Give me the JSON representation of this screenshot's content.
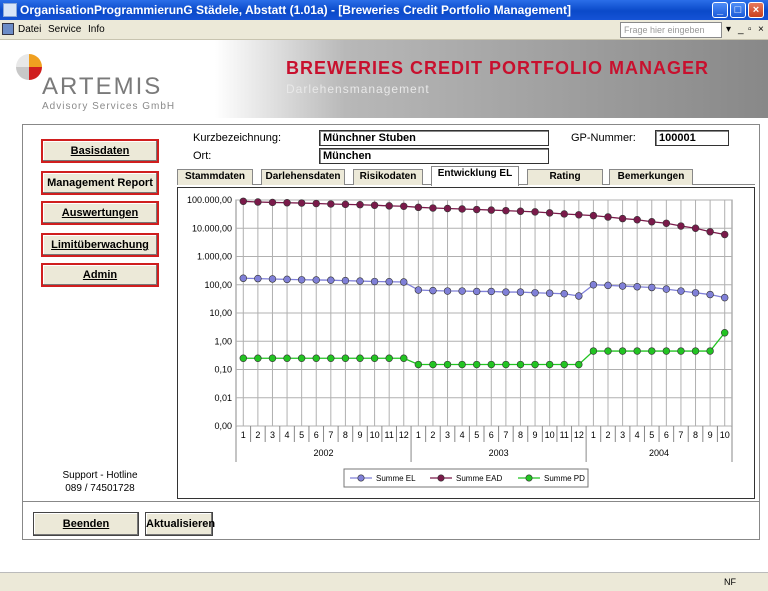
{
  "window": {
    "title": "OrganisationProgrammierunG Städele, Abstatt (1.01a) - [Breweries Credit Portfolio Management]"
  },
  "menu": {
    "items": [
      "Datei",
      "Service",
      "Info"
    ],
    "help_placeholder": "Frage hier eingeben"
  },
  "banner": {
    "logo": "ARTEMIS",
    "logo_sub": "Advisory Services GmbH",
    "title": "BREWERIES CREDIT PORTFOLIO MANAGER",
    "subtitle": "Darlehensmanagement"
  },
  "nav": {
    "basisdaten": "Basisdaten",
    "management_report": "Management Report",
    "auswertungen": "Auswertungen",
    "limitueberwachung": "Limitüberwachung",
    "admin": "Admin"
  },
  "support": {
    "line1": "Support - Hotline",
    "line2": "089 / 74501728"
  },
  "header_fields": {
    "kurz_label": "Kurzbezeichnung:",
    "kurz_value": "Münchner Stuben",
    "ort_label": "Ort:",
    "ort_value": "München",
    "gp_label": "GP-Nummer:",
    "gp_value": "100001"
  },
  "tabs": [
    "Stammdaten",
    "Darlehensdaten",
    "Risikodaten",
    "Entwicklung EL",
    "Rating",
    "Bemerkungen"
  ],
  "active_tab": "Entwicklung EL",
  "footer": {
    "beenden": "Beenden",
    "aktualisieren": "Aktualisieren"
  },
  "status": {
    "right": "NF"
  },
  "colors": {
    "accent_red": "#c8102e",
    "series_el": "#8080d8",
    "series_ead": "#7a1a4a",
    "series_pd": "#22c422"
  },
  "chart_data": {
    "type": "line",
    "y_scale": "log",
    "ylim": [
      0.001,
      100000
    ],
    "y_ticks": [
      {
        "value": 100000,
        "label": "100.000,00"
      },
      {
        "value": 10000,
        "label": "10.000,00"
      },
      {
        "value": 1000,
        "label": "1.000,00"
      },
      {
        "value": 100,
        "label": "100,00"
      },
      {
        "value": 10,
        "label": "10,00"
      },
      {
        "value": 1,
        "label": "1,00"
      },
      {
        "value": 0.1,
        "label": "0,10"
      },
      {
        "value": 0.01,
        "label": "0,01"
      },
      {
        "value": 0.001,
        "label": "0,00"
      }
    ],
    "grid": true,
    "legend_position": "bottom",
    "categories": [
      "1",
      "2",
      "3",
      "4",
      "5",
      "6",
      "7",
      "8",
      "9",
      "10",
      "11",
      "12",
      "1",
      "2",
      "3",
      "4",
      "5",
      "6",
      "7",
      "8",
      "9",
      "10",
      "11",
      "12",
      "1",
      "2",
      "3",
      "4",
      "5",
      "6",
      "7",
      "8",
      "9",
      "10"
    ],
    "years": [
      {
        "label": "2002",
        "months": 12
      },
      {
        "label": "2003",
        "months": 12
      },
      {
        "label": "2004",
        "months": 10
      }
    ],
    "series": [
      {
        "name": "Summe EL",
        "color": "#8080d8",
        "values": [
          170,
          165,
          160,
          155,
          150,
          148,
          145,
          140,
          135,
          130,
          128,
          125,
          65,
          62,
          60,
          60,
          58,
          58,
          55,
          55,
          52,
          50,
          48,
          40,
          100,
          95,
          90,
          85,
          80,
          70,
          60,
          52,
          45,
          35
        ]
      },
      {
        "name": "Summe EAD",
        "color": "#7a1a4a",
        "values": [
          90000,
          85000,
          82000,
          80000,
          78000,
          75000,
          72000,
          70000,
          68000,
          65000,
          62000,
          60000,
          55000,
          52000,
          50000,
          48000,
          46000,
          44000,
          42000,
          40000,
          38000,
          35000,
          32000,
          30000,
          28000,
          25000,
          22000,
          20000,
          17000,
          15000,
          12000,
          10000,
          7500,
          6000
        ]
      },
      {
        "name": "Summe PD",
        "color": "#22c422",
        "values": [
          0.25,
          0.25,
          0.25,
          0.25,
          0.25,
          0.25,
          0.25,
          0.25,
          0.25,
          0.25,
          0.25,
          0.25,
          0.15,
          0.15,
          0.15,
          0.15,
          0.15,
          0.15,
          0.15,
          0.15,
          0.15,
          0.15,
          0.15,
          0.15,
          0.45,
          0.45,
          0.45,
          0.45,
          0.45,
          0.45,
          0.45,
          0.45,
          0.45,
          2.0
        ]
      }
    ]
  }
}
